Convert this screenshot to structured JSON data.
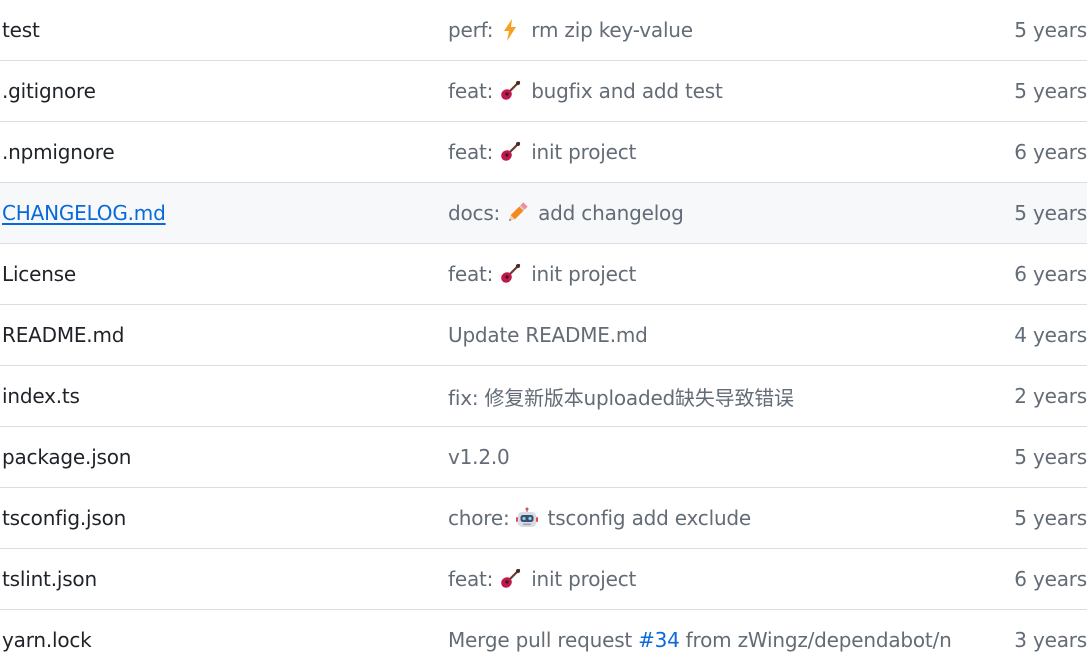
{
  "files": [
    {
      "name": "test",
      "commit": {
        "prefix": "perf:",
        "emoji": "zap",
        "text": "rm zip key-value"
      },
      "age": "5 years"
    },
    {
      "name": ".gitignore",
      "commit": {
        "prefix": "feat:",
        "emoji": "guitar",
        "text": "bugfix and add test"
      },
      "age": "5 years"
    },
    {
      "name": ".npmignore",
      "commit": {
        "prefix": "feat:",
        "emoji": "guitar",
        "text": "init project"
      },
      "age": "6 years"
    },
    {
      "name": "CHANGELOG.md",
      "commit": {
        "prefix": "docs:",
        "emoji": "pencil",
        "text": "add changelog"
      },
      "age": "5 years"
    },
    {
      "name": "License",
      "commit": {
        "prefix": "feat:",
        "emoji": "guitar",
        "text": "init project"
      },
      "age": "6 years"
    },
    {
      "name": "README.md",
      "commit": {
        "text": "Update README.md"
      },
      "age": "4 years"
    },
    {
      "name": "index.ts",
      "commit": {
        "text": "fix: 修复新版本uploaded缺失导致错误"
      },
      "age": "2 years"
    },
    {
      "name": "package.json",
      "commit": {
        "text": "v1.2.0"
      },
      "age": "5 years"
    },
    {
      "name": "tsconfig.json",
      "commit": {
        "prefix": "chore:",
        "emoji": "robot",
        "text": "tsconfig add exclude"
      },
      "age": "5 years"
    },
    {
      "name": "tslint.json",
      "commit": {
        "prefix": "feat:",
        "emoji": "guitar",
        "text": "init project"
      },
      "age": "6 years"
    },
    {
      "name": "yarn.lock",
      "commit": {
        "prefix": "Merge pull request",
        "link": "#34",
        "text": "from zWingz/dependabot/n..."
      },
      "age": "3 years"
    }
  ],
  "colors": {
    "link": "#0969da",
    "text": "#1f2328",
    "muted": "#636c76",
    "border": "#d8dee4",
    "hover_bg": "#f6f8fa"
  }
}
